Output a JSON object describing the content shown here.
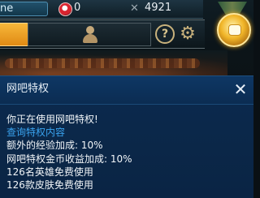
{
  "hud": {
    "name_partial": "ne",
    "rp": "0",
    "ip": "4921",
    "help_glyph": "?",
    "gear_glyph": "⚙",
    "ip_glyph": "✕",
    "colors": {
      "accent_orange": "#f0a02a",
      "gold": "#c9b27c",
      "medal_gold": "#f1b629"
    }
  },
  "dialog": {
    "title": "网吧特权",
    "close_glyph": "✕",
    "lines": [
      "你正在使用网吧特权!",
      "查询特权内容",
      "额外的经验加成: 10%",
      "网吧特权金币收益加成: 10%",
      "126名英雄免费使用",
      "126款皮肤免费使用"
    ],
    "colors": {
      "background": "#0b2a4f",
      "link": "#3aa4f0",
      "text": "#f1f5f8"
    }
  },
  "icons": {
    "rp": "rp-currency-icon",
    "ip": "ip-currency-icon",
    "profile": "person-icon",
    "help": "help-icon",
    "settings": "gear-icon",
    "medal": "medal-icon",
    "close": "close-icon"
  }
}
